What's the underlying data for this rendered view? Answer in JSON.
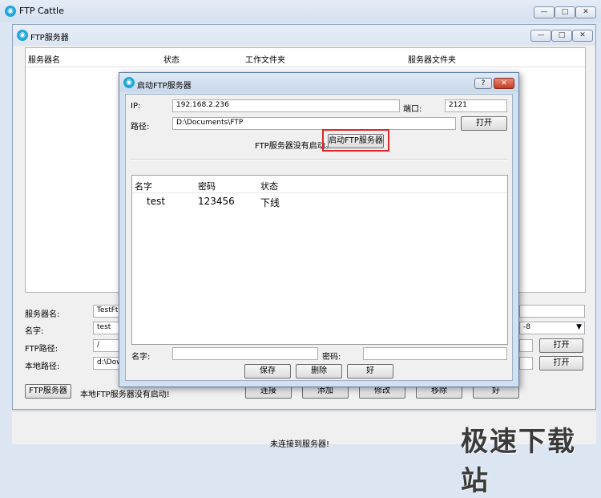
{
  "app": {
    "title": "FTP Cattle",
    "icon": "app-icon"
  },
  "window_controls": {
    "minimize": "—",
    "maximize": "□",
    "close": "✕"
  },
  "inner_window": {
    "title": "FTP服务器"
  },
  "server_list": {
    "columns": [
      "服务器名",
      "状态",
      "工作文件夹",
      "服务器文件夹"
    ]
  },
  "form": {
    "server_name_label": "服务器名:",
    "server_name_value": "TestFt",
    "name_label": "名字:",
    "name_value": "test",
    "ftp_path_label": "FTP路径:",
    "ftp_path_value": "/",
    "local_path_label": "本地路径:",
    "local_path_value": "d:\\Dow",
    "encoding_value": "-8",
    "open_button_1": "打开",
    "open_button_2": "打开",
    "ftp_server_button": "FTP服务器",
    "local_status_text": "本地FTP服务器没有启动!",
    "connect_button": "连接",
    "add_button": "添加",
    "modify_button": "修改",
    "remove_button": "移除",
    "ok_button": "好"
  },
  "status_bar": {
    "text": "未连接到服务器!"
  },
  "dialog": {
    "title": "启动FTP服务器",
    "help": "?",
    "close": "✕",
    "ip_label": "IP:",
    "ip_value": "192.168.2.236",
    "port_label": "端口:",
    "port_value": "2121",
    "path_label": "路径:",
    "path_value": "D:\\Documents\\FTP",
    "open_button": "打开",
    "status_text": "FTP服务器没有启动。",
    "start_button": "启动FTP服务器",
    "user_columns": [
      "名字",
      "密码",
      "状态"
    ],
    "users": [
      {
        "name": "test",
        "password": "123456",
        "status": "下线"
      }
    ],
    "name_label": "名字:",
    "name_value": "",
    "password_label": "密码:",
    "password_value": "",
    "save_button": "保存",
    "delete_button": "删除",
    "ok_button": "好"
  },
  "watermark": {
    "text": "极速下载站"
  },
  "colors": {
    "highlight_box": "#e0262a",
    "close_button": "#c53a22",
    "app_icon": "#1ea7d8"
  }
}
